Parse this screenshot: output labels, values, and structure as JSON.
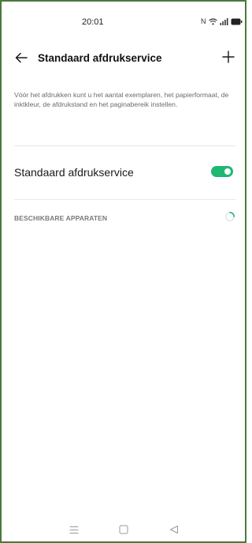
{
  "status_bar": {
    "time": "20:01",
    "icons": [
      "nfc-icon",
      "wifi-icon",
      "signal-icon",
      "battery-icon"
    ],
    "nfc_glyph": "N"
  },
  "header": {
    "title": "Standaard afdrukservice",
    "back_icon": "arrow-left-icon",
    "add_icon": "plus-icon"
  },
  "description": "Vóór het afdrukken kunt u het aantal exemplaren, het papierformaat, de inktkleur, de afdrukstand en het paginabereik instellen.",
  "setting": {
    "label": "Standaard afdrukservice",
    "enabled": true,
    "toggle_color": "#1fb873"
  },
  "available_devices": {
    "header": "BESCHIKBARE APPARATEN",
    "loading_icon": "spinner-icon"
  },
  "nav_bar": {
    "icons": [
      "menu-icon",
      "home-icon",
      "back-triangle-icon"
    ]
  },
  "colors": {
    "accent": "#1fb873",
    "frame_border": "#4a7a3a"
  }
}
